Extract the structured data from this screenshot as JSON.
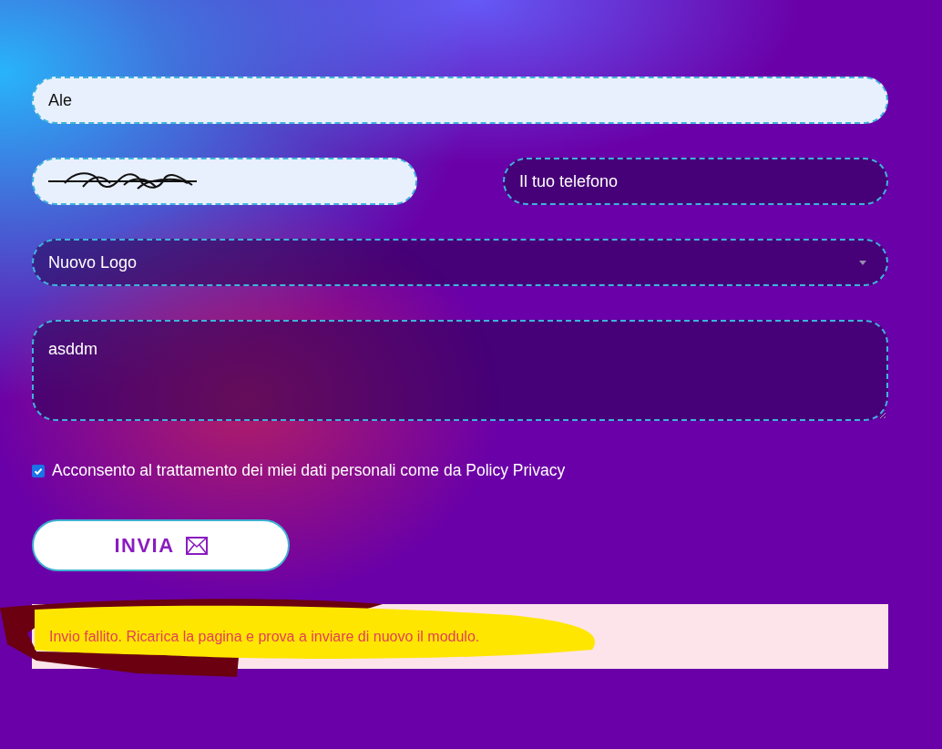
{
  "form": {
    "name": {
      "value": "Ale",
      "autofilled": true
    },
    "email": {
      "redacted": true,
      "autofilled": true
    },
    "phone": {
      "placeholder": "Il tuo telefono",
      "autofilled": false
    },
    "service": {
      "value": "Nuovo Logo"
    },
    "message": {
      "value": "asddm"
    },
    "consent": {
      "label": "Acconsento al trattamento dei miei dati personali come da Policy Privacy",
      "checked": true
    },
    "submit": {
      "label": "INVIA"
    },
    "error": {
      "text": "Invio fallito. Ricarica la pagina e prova a inviare di nuovo il modulo.",
      "highlighted": true
    }
  }
}
